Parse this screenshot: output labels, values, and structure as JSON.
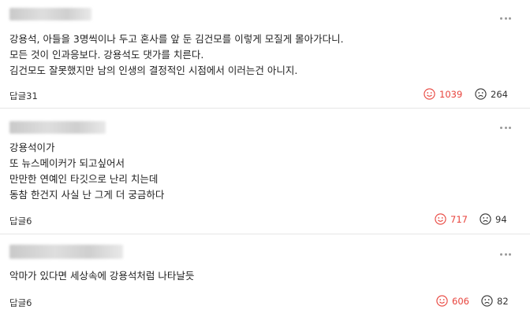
{
  "comments": [
    {
      "author": "",
      "lines": [
        "강용석,  아들을  3명씩이나   두고 혼사를 앞 둔  김건모를 이렇게 모질게  몰아가다니.",
        "모든 것이 인과응보다.  강용석도  댓가를 치른다.",
        "김건모도 잘못했지만  남의 인생의 결정적인 시점에서 이러는건 아니지."
      ],
      "reply_label": "답글",
      "reply_count": "31",
      "likes": "1039",
      "dislikes": "264"
    },
    {
      "author": "",
      "lines": [
        "강용석이가",
        "또 뉴스메이커가 되고싶어서",
        "만만한 연예인 타깃으로 난리 치는데",
        "동참 한건지 사실 난 그게 더 궁금하다"
      ],
      "reply_label": "답글",
      "reply_count": "6",
      "likes": "717",
      "dislikes": "94"
    },
    {
      "author": "",
      "lines": [
        "악마가 있다면  세상속에 강용석처럼 나타날듯"
      ],
      "reply_label": "답글",
      "reply_count": "6",
      "likes": "606",
      "dislikes": "82"
    }
  ],
  "colors": {
    "like": "#e8433c",
    "divider": "#e6e6e6"
  },
  "icons": {
    "more": "more-vertical-dots-icon",
    "like": "smile-face-icon",
    "dislike": "sad-face-icon"
  }
}
